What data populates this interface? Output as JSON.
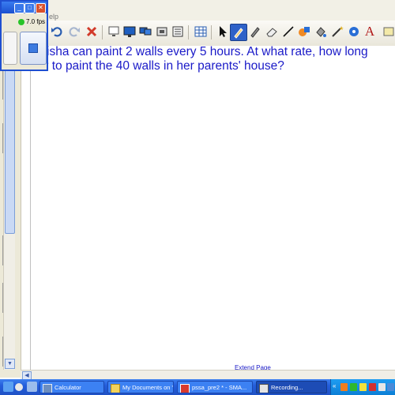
{
  "app": {
    "menu_text": "elp"
  },
  "recorder": {
    "fps_label": "7.0 fps",
    "minimize_glyph": "_",
    "maximize_glyph": "□",
    "close_glyph": "✕",
    "status_color": "#28c428"
  },
  "toolbar": {
    "icons": [
      "undo-icon",
      "redo-icon",
      "delete-icon",
      "screen-shade-icon",
      "display-icon",
      "dual-display-icon",
      "capture-icon",
      "document-camera-icon",
      "table-icon",
      "select-icon",
      "pen-icon",
      "creative-pen-icon",
      "eraser-icon",
      "line-icon",
      "shapes-icon",
      "fill-icon",
      "magic-pen-icon",
      "properties-icon",
      "text-icon"
    ],
    "text_tool_glyph": "A"
  },
  "page": {
    "problem_line1": "isha can paint 2 walls every 5 hours. At what rate, how long",
    "problem_line2": "her to paint the 40 walls in her parents' house?",
    "extend_link": "Extend Page",
    "text_color": "#1a1ac8"
  },
  "taskbar": {
    "items": [
      {
        "label": "Calculator"
      },
      {
        "label": "My Documents on '..."
      },
      {
        "label": "pssa_pre2 * - SMA..."
      },
      {
        "label": "Recording..."
      }
    ]
  }
}
